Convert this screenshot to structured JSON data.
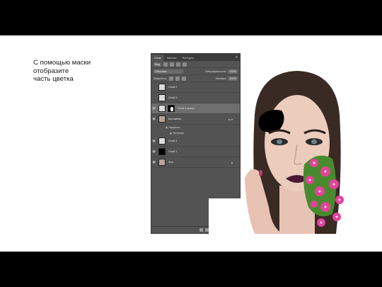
{
  "slide": {
    "caption": "С помощью маски\nотобразите\nчасть цветка"
  },
  "ps_panel": {
    "tabs": [
      "Слои",
      "Каналы",
      "Контуры"
    ],
    "filter_label": "Вид",
    "blend_mode": "Обычные",
    "opacity_label": "Непрозрачность:",
    "opacity_value": "100%",
    "lock_label": "Закрепить:",
    "fill_label": "Заливка:",
    "fill_value": "100%",
    "layers": [
      {
        "name": "Слой 2"
      },
      {
        "name": "Слой 3"
      },
      {
        "name": "Слой 4 копия"
      },
      {
        "name": "Без имени"
      },
      {
        "name": "Эффекты"
      },
      {
        "name": "Тиснение"
      },
      {
        "name": "Слой 4"
      },
      {
        "name": "Слой 1"
      },
      {
        "name": "Фон"
      }
    ]
  },
  "colors": {
    "panel_bg": "#535353",
    "selected_layer": "#6e6e6e",
    "flower_pink": "#e2449a",
    "leaf_green": "#4a8a2e"
  },
  "icons": [
    "eye-icon",
    "fx-icon",
    "lock-icon",
    "panel-menu-icon"
  ]
}
